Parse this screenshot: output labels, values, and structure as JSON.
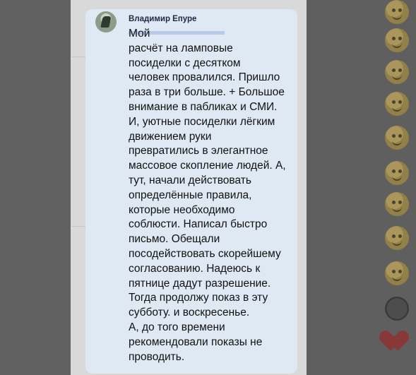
{
  "chat": {
    "author": "Владимир Епуре",
    "message": "Мой\nрасчёт на ламповые\nпосиделки с десятком\nчеловек провалился. Пришло\nраза в три больше. + Большое\nвнимание в пабликах и СМИ.\nИ, уютные посиделки лёгким\nдвижением руки\nпревратились в элегантное\nмассовое скопление людей. А,\nтут, начали действовать\nопределённые правила,\nкоторые необходимо\nсоблюсти. Написал быстро\nписьмо. Обещали\nпосодействовать скорейшему\nсогласованию. Надеюсь к\nпятнице дадут разрешение.\nТогда продолжу показ в эту\nсубботу. и воскресенье.\nА, до того времени\nрекомендовали  показы не\nпроводить."
  },
  "emoji_panel": {
    "icons": [
      "smile-icon",
      "tongue-icon",
      "wink-icon",
      "happy-icon",
      "smirk-icon",
      "grin-icon",
      "neutral-icon",
      "cry-icon",
      "laugh-icon",
      "sad-icon",
      "angry-icon",
      "surprised-icon",
      "shy-icon",
      "ninja-icon",
      "heart-icon",
      "thumbs-icon"
    ]
  },
  "colors": {
    "bubble": "#dfe9f4",
    "author": "#1a2a46",
    "overlay": "#5d5d5d"
  }
}
